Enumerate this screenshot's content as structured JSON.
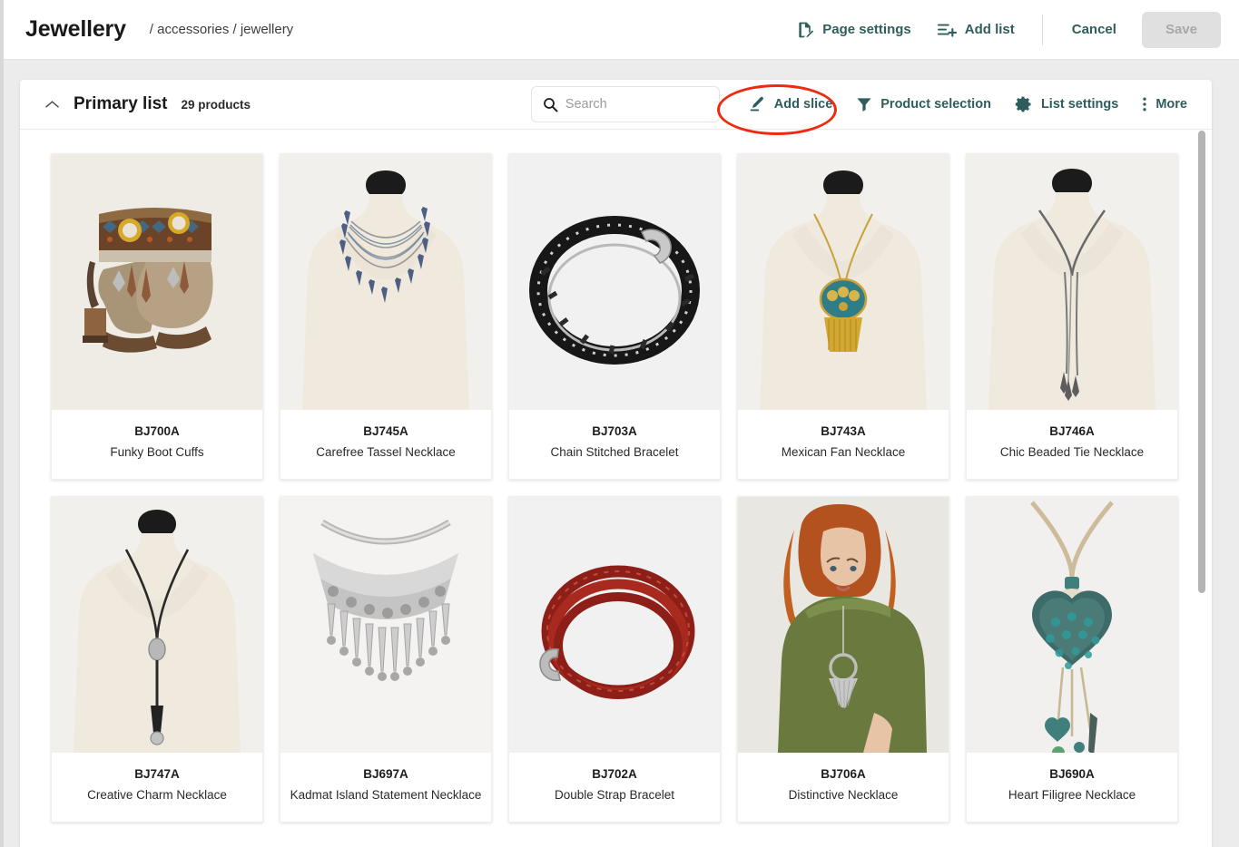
{
  "header": {
    "brand_title": "Jewellery",
    "breadcrumb": "/ accessories / jewellery",
    "actions": [
      {
        "label": "Page settings",
        "icon": "page-settings-icon"
      },
      {
        "label": "Add list",
        "icon": "add-list-icon"
      }
    ],
    "cancel_label": "Cancel",
    "save_label": "Save"
  },
  "list": {
    "title": "Primary list",
    "count_label": "29 products",
    "collapse_icon": "chevron-up-icon"
  },
  "search": {
    "placeholder": "Search",
    "value": "",
    "icon": "search-icon"
  },
  "toolbar": {
    "items": [
      {
        "label": "Add slice",
        "icon": "pen-icon",
        "annotated": true
      },
      {
        "label": "Product selection",
        "icon": "filter-icon",
        "annotated": false
      },
      {
        "label": "List settings",
        "icon": "gear-icon",
        "annotated": false
      },
      {
        "label": "More",
        "icon": "kebab-menu-icon",
        "annotated": false
      }
    ]
  },
  "colors": {
    "accent_teal": "#2f5d5d",
    "annotation_red": "#f02a10",
    "page_bg": "#ececec",
    "panel_bg": "#ffffff",
    "save_disabled_bg": "#e0e0e0"
  },
  "products": [
    {
      "sku": "BJ700A",
      "name": "Funky Boot Cuffs",
      "art": "boots"
    },
    {
      "sku": "BJ745A",
      "name": "Carefree Tassel Necklace",
      "art": "mannequin-blue-tassel"
    },
    {
      "sku": "BJ703A",
      "name": "Chain Stitched Bracelet",
      "art": "black-bracelet"
    },
    {
      "sku": "BJ743A",
      "name": "Mexican Fan Necklace",
      "art": "mannequin-gold-fan"
    },
    {
      "sku": "BJ746A",
      "name": "Chic Beaded Tie Necklace",
      "art": "mannequin-beaded-tie"
    },
    {
      "sku": "BJ747A",
      "name": "Creative Charm Necklace",
      "art": "mannequin-charm"
    },
    {
      "sku": "BJ697A",
      "name": "Kadmat Island Statement Necklace",
      "art": "silver-statement"
    },
    {
      "sku": "BJ702A",
      "name": "Double Strap Bracelet",
      "art": "red-bracelet"
    },
    {
      "sku": "BJ706A",
      "name": "Distinctive Necklace",
      "art": "model-green-top"
    },
    {
      "sku": "BJ690A",
      "name": "Heart Filigree Necklace",
      "art": "heart-filigree"
    }
  ]
}
